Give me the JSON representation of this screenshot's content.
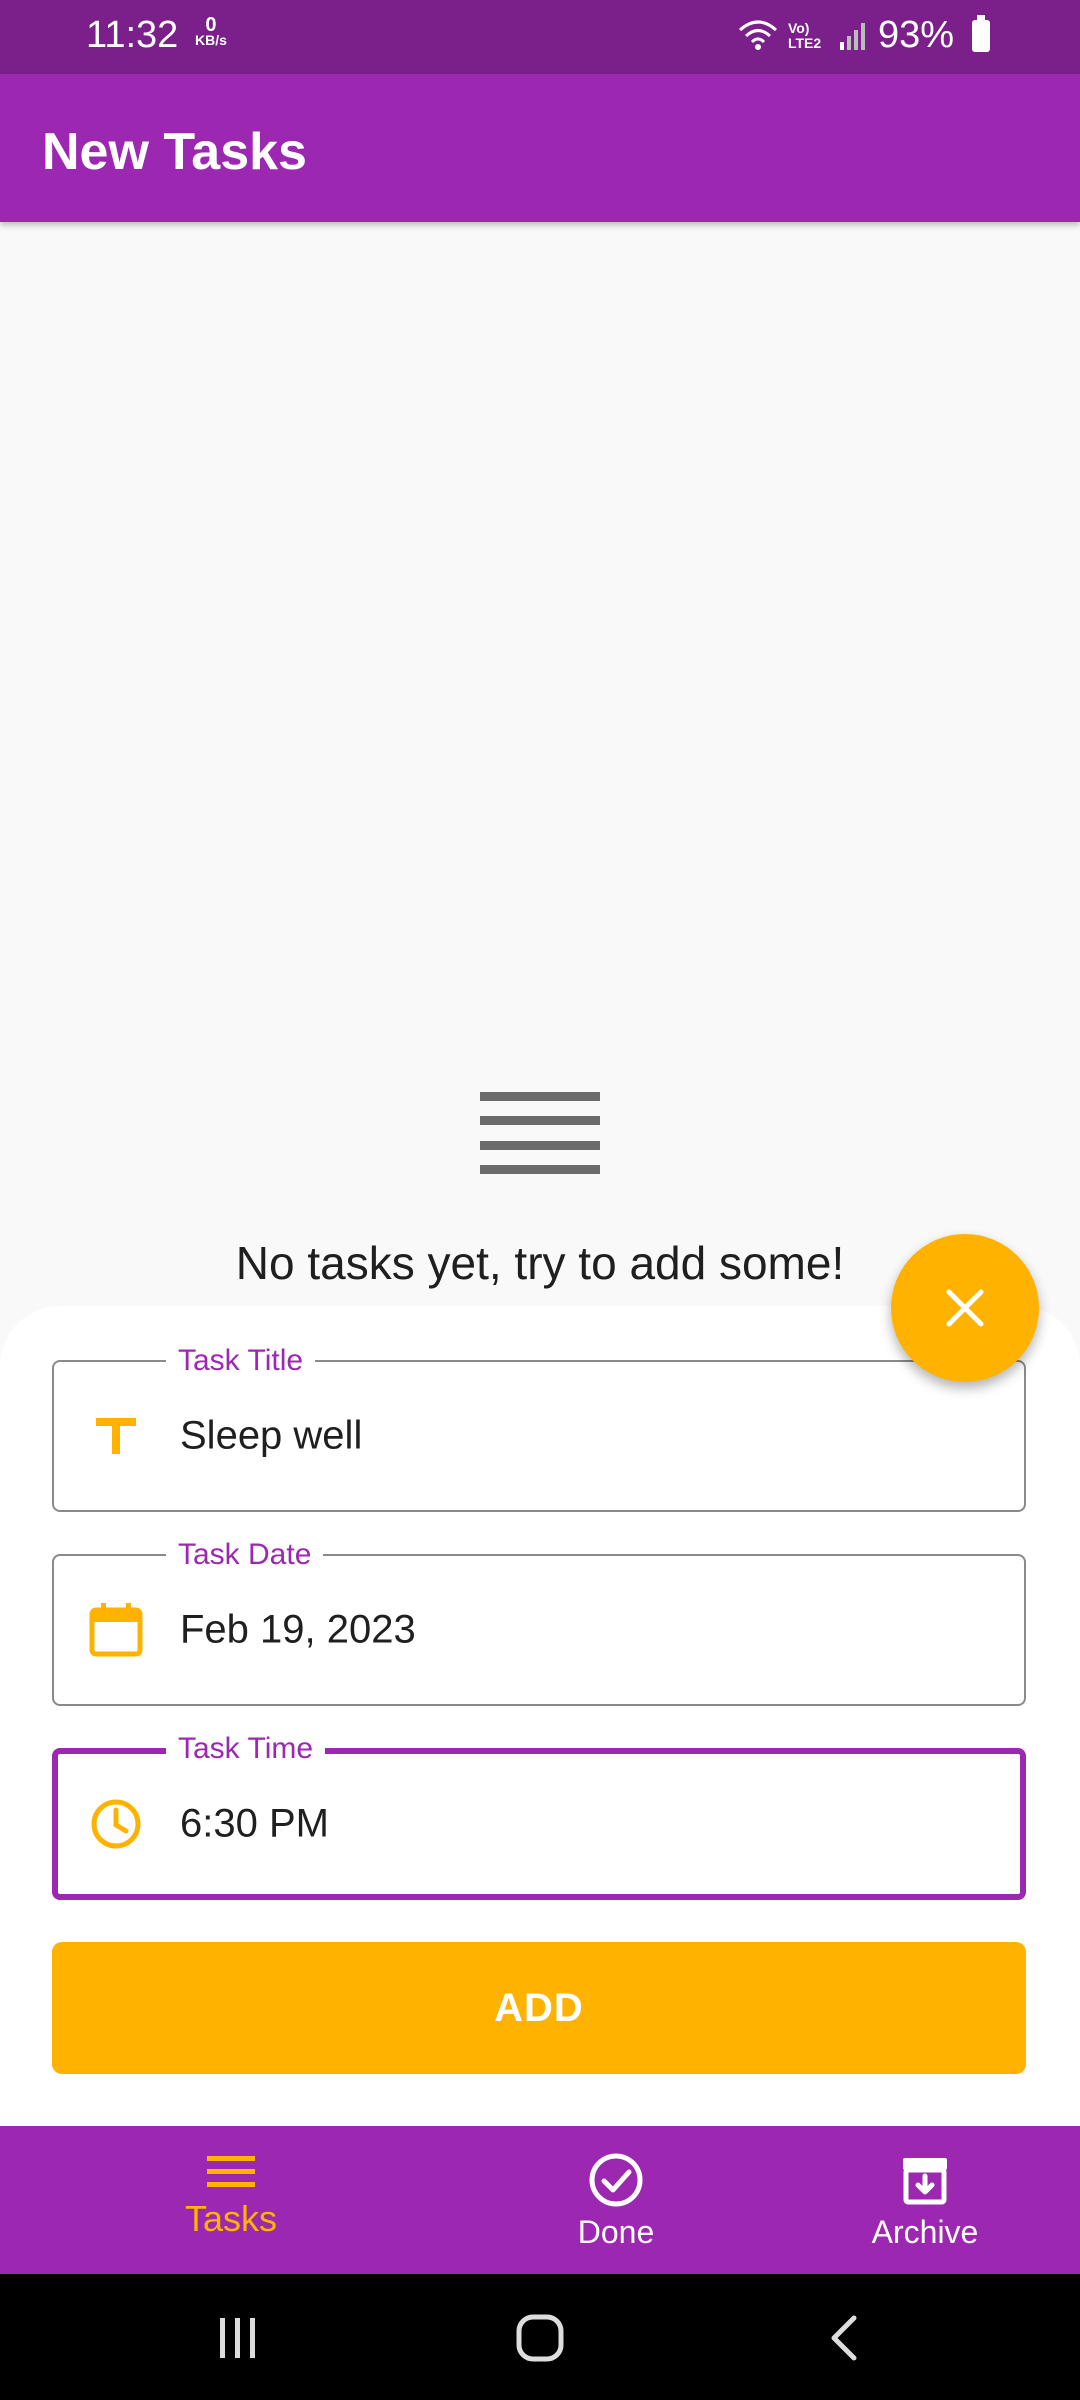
{
  "status_bar": {
    "time": "11:32",
    "speed_value": "0",
    "speed_unit": "KB/s",
    "network_label": "Vo) LTE2",
    "battery": "93%"
  },
  "app_bar": {
    "title": "New Tasks"
  },
  "empty_state": {
    "icon": "menu-icon",
    "message": "No tasks yet, try to add some!"
  },
  "form": {
    "title_field": {
      "label": "Task Title",
      "value": "Sleep well",
      "icon": "title-icon"
    },
    "date_field": {
      "label": "Task Date",
      "value": "Feb 19, 2023",
      "icon": "calendar-icon"
    },
    "time_field": {
      "label": "Task Time",
      "value": "6:30 PM",
      "icon": "clock-icon"
    },
    "add_label": "ADD"
  },
  "fab": {
    "icon": "close-icon"
  },
  "bottom_nav": {
    "items": [
      {
        "label": "Tasks",
        "icon": "menu-icon",
        "selected": true
      },
      {
        "label": "Done",
        "icon": "check-circle-icon",
        "selected": false
      },
      {
        "label": "Archive",
        "icon": "archive-icon",
        "selected": false
      }
    ]
  },
  "colors": {
    "primary": "#9c27b0",
    "status_bar": "#7b1f8b",
    "accent": "#ffb300"
  }
}
